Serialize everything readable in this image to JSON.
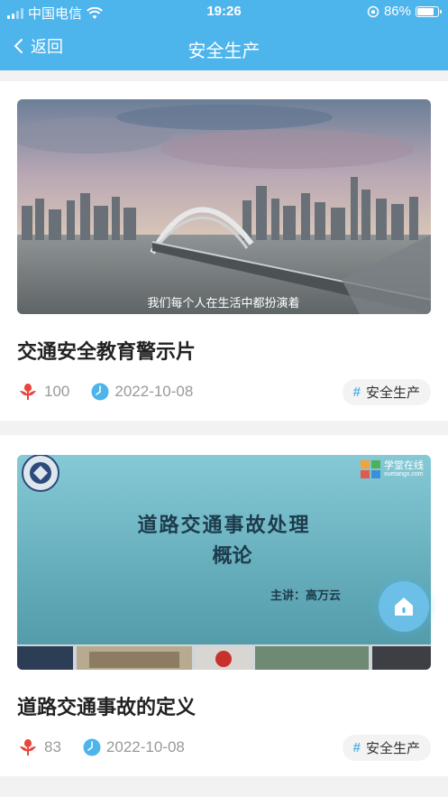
{
  "status_bar": {
    "carrier": "中国电信",
    "time": "19:26",
    "battery_percent": "86%",
    "battery_level": 0.86
  },
  "nav": {
    "back_label": "返回",
    "title": "安全生产"
  },
  "articles": [
    {
      "title": "交通安全教育警示片",
      "subtitle_caption": "我们每个人在生活中都扮演着",
      "likes": "100",
      "date": "2022-10-08",
      "tag": "安全生产"
    },
    {
      "title": "道路交通事故的定义",
      "thumbnail": {
        "heading_line1": "道路交通事故处理",
        "heading_line2": "概论",
        "speaker": "主讲：高万云",
        "brand_name": "学堂在线",
        "brand_url": "xuetangx.com"
      },
      "likes": "83",
      "date": "2022-10-08",
      "tag": "安全生产"
    }
  ],
  "colors": {
    "accent": "#4db4ec",
    "like_red": "#e8453c"
  },
  "icons": {
    "like": "rose-icon",
    "date": "clock-icon",
    "float_button": "home-icon"
  }
}
